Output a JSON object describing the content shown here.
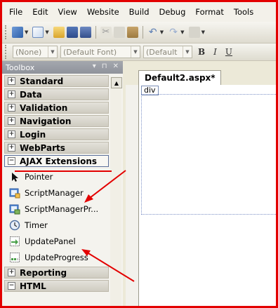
{
  "menu": [
    "File",
    "Edit",
    "View",
    "Website",
    "Build",
    "Debug",
    "Format",
    "Tools"
  ],
  "format_toolbar": {
    "style": "(None)",
    "font": "(Default Font)",
    "size": "(Default",
    "bold": "B",
    "italic": "I",
    "underline": "U"
  },
  "toolbox": {
    "title": "Toolbox",
    "pin": "− ⊕ ×",
    "categories_top": [
      {
        "label": "Standard",
        "expander": "+"
      },
      {
        "label": "Data",
        "expander": "+"
      },
      {
        "label": "Validation",
        "expander": "+"
      },
      {
        "label": "Navigation",
        "expander": "+"
      },
      {
        "label": "Login",
        "expander": "+"
      },
      {
        "label": "WebParts",
        "expander": "+"
      }
    ],
    "active_category": {
      "label": "AJAX Extensions",
      "expander": "−"
    },
    "tools": [
      {
        "label": "Pointer",
        "icon": "pointer-icon"
      },
      {
        "label": "ScriptManager",
        "icon": "script-manager-icon"
      },
      {
        "label": "ScriptManagerPr...",
        "icon": "script-manager-proxy-icon"
      },
      {
        "label": "Timer",
        "icon": "timer-icon"
      },
      {
        "label": "UpdatePanel",
        "icon": "update-panel-icon"
      },
      {
        "label": "UpdateProgress",
        "icon": "update-progress-icon"
      }
    ],
    "categories_bottom": [
      {
        "label": "Reporting",
        "expander": "+"
      },
      {
        "label": "HTML",
        "expander": "−"
      }
    ]
  },
  "editor": {
    "tab": "Default2.aspx*",
    "div_tag": "div"
  },
  "colors": {
    "annotation": "#e30000",
    "selection": "#5b6f9a"
  }
}
